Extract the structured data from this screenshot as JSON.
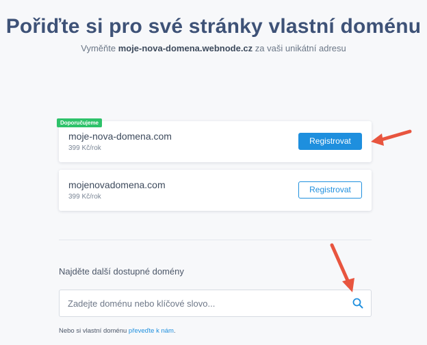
{
  "header": {
    "title": "Pořiďte si pro své stránky vlastní doménu",
    "subtitle_prefix": "Vyměňte ",
    "subtitle_domain": "moje-nova-domena.webnode.cz",
    "subtitle_suffix": " za vaši unikátní adresu"
  },
  "offers": [
    {
      "badge": "Doporučujeme",
      "domain": "moje-nova-domena.com",
      "price": "399 Kč/rok",
      "button_label": "Registrovat"
    },
    {
      "domain": "mojenovadomena.com",
      "price": "399 Kč/rok",
      "button_label": "Registrovat"
    }
  ],
  "search": {
    "heading": "Najděte další dostupné domény",
    "placeholder": "Zadejte doménu nebo klíčové slovo...",
    "value": ""
  },
  "transfer": {
    "text": "Nebo si vlastní doménu ",
    "link_label": "převeďte k nám",
    "suffix": "."
  },
  "colors": {
    "title": "#3e5277",
    "accent": "#1e8fde",
    "badge": "#2ec26a",
    "annotation_arrow": "#e8553f"
  },
  "icons": {
    "search": "search-icon",
    "annotation": "red-arrow-icon"
  }
}
